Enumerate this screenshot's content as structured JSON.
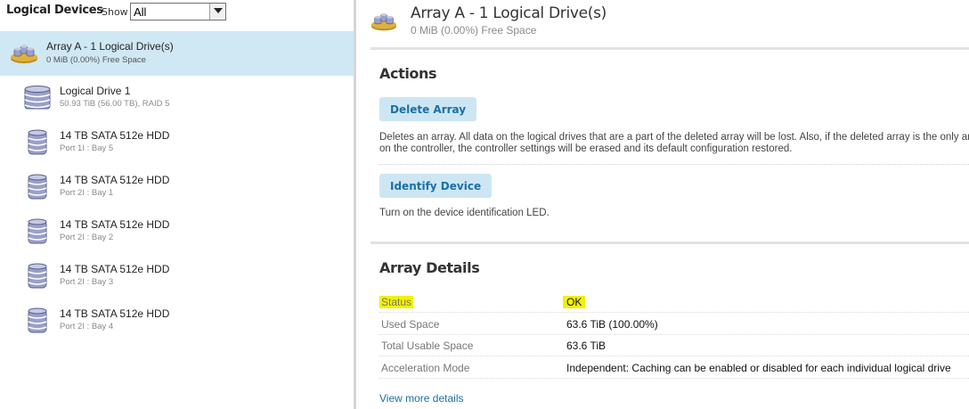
{
  "left_panel": {
    "title": "Logical Devices",
    "show_label": "Show",
    "filter_value": "All",
    "items": [
      {
        "name": "Array A - 1 Logical Drive(s)",
        "detail": "0 MiB (0.00%) Free Space",
        "icon": "array-icon",
        "selected": true
      },
      {
        "name": "Logical Drive 1",
        "detail": "50.93 TiB (56.00 TB), RAID 5",
        "icon": "logical-drive-icon"
      },
      {
        "name": "14 TB SATA 512e HDD",
        "detail": "Port 1I : Bay 5",
        "icon": "physical-drive-icon"
      },
      {
        "name": "14 TB SATA 512e HDD",
        "detail": "Port 2I : Bay 1",
        "icon": "physical-drive-icon"
      },
      {
        "name": "14 TB SATA 512e HDD",
        "detail": "Port 2I : Bay 2",
        "icon": "physical-drive-icon"
      },
      {
        "name": "14 TB SATA 512e HDD",
        "detail": "Port 2I : Bay 3",
        "icon": "physical-drive-icon"
      },
      {
        "name": "14 TB SATA 512e HDD",
        "detail": "Port 2I : Bay 4",
        "icon": "physical-drive-icon"
      }
    ]
  },
  "header": {
    "title": "Array A - 1 Logical Drive(s)",
    "subtitle": "0 MiB (0.00%) Free Space"
  },
  "actions": {
    "heading": "Actions",
    "delete_label": "Delete Array",
    "delete_desc": "Deletes an array. All data on the logical drives that are a part of the deleted array will be lost. Also, if the deleted array is the only array on the controller, the controller settings will be erased and its default configuration restored.",
    "identify_label": "Identify Device",
    "identify_desc": "Turn on the device identification LED."
  },
  "details": {
    "heading": "Array Details",
    "rows": [
      {
        "label": "Status",
        "value": "OK",
        "highlight": true
      },
      {
        "label": "Used Space",
        "value": "63.6 TiB (100.00%)"
      },
      {
        "label": "Total Usable Space",
        "value": "63.6 TiB"
      },
      {
        "label": "Acceleration Mode",
        "value": "Independent: Caching can be enabled or disabled for each individual logical drive"
      }
    ],
    "view_more": "View more details"
  },
  "colors": {
    "selected_bg": "#cfe8f4",
    "button_bg": "#cde6f3",
    "link": "#1a6fa8",
    "highlight": "#f2f200"
  }
}
